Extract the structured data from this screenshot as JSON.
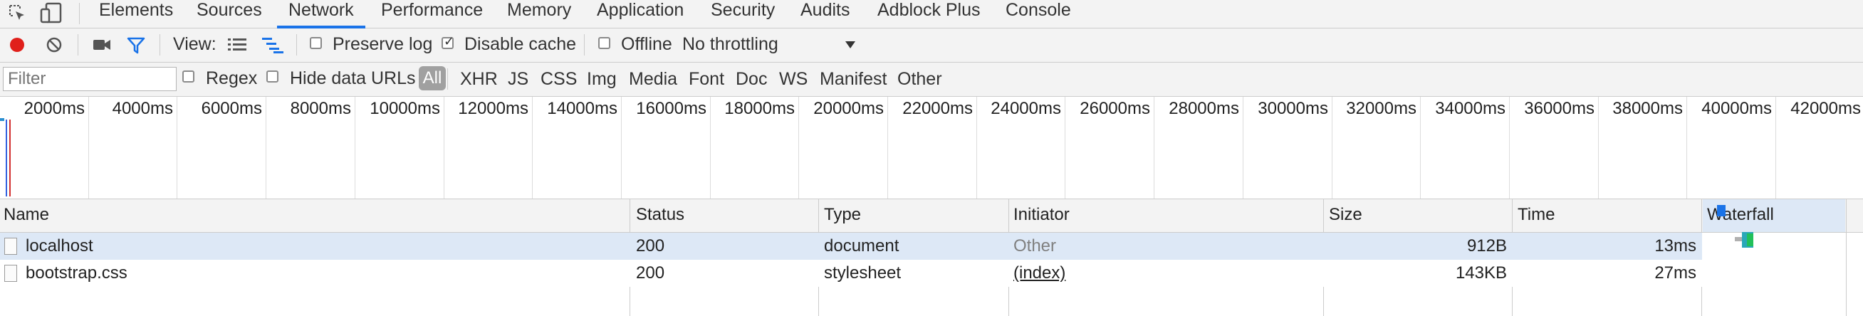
{
  "tabs": [
    "Elements",
    "Sources",
    "Network",
    "Performance",
    "Memory",
    "Application",
    "Security",
    "Audits",
    "Adblock Plus",
    "Console"
  ],
  "selected_tab": "Network",
  "toolbar": {
    "view_label": "View:",
    "preserve_log": {
      "label": "Preserve log",
      "checked": false
    },
    "disable_cache": {
      "label": "Disable cache",
      "checked": true
    },
    "offline": {
      "label": "Offline",
      "checked": false
    },
    "throttling": "No throttling",
    "record_color": "#e0201b",
    "accent_color": "#1a73e8",
    "icons": [
      "inspect-icon",
      "device-icon",
      "record-icon",
      "clear-icon",
      "camera-icon",
      "filter-icon",
      "large-rows-icon",
      "waterfall-overview-icon",
      "dropdown-icon"
    ]
  },
  "filterbar": {
    "filter_placeholder": "Filter",
    "regex": "Regex",
    "hide_data_urls": "Hide data URLs",
    "types": [
      "All",
      "XHR",
      "JS",
      "CSS",
      "Img",
      "Media",
      "Font",
      "Doc",
      "WS",
      "Manifest",
      "Other"
    ],
    "selected_type": "All"
  },
  "timeline_ticks": [
    "2000ms",
    "4000ms",
    "6000ms",
    "8000ms",
    "10000ms",
    "12000ms",
    "14000ms",
    "16000ms",
    "18000ms",
    "20000ms",
    "22000ms",
    "24000ms",
    "26000ms",
    "28000ms",
    "30000ms",
    "32000ms",
    "34000ms",
    "36000ms",
    "38000ms",
    "40000ms",
    "42000ms"
  ],
  "table": {
    "columns": [
      "Name",
      "Status",
      "Type",
      "Initiator",
      "Size",
      "Time",
      "Waterfall"
    ],
    "rows": [
      {
        "name": "localhost",
        "status": "200",
        "type": "document",
        "initiator": "Other",
        "size": "912B",
        "time": "13ms",
        "selected": true
      },
      {
        "name": "bootstrap.css",
        "status": "200",
        "type": "stylesheet",
        "initiator": "(index)",
        "size": "143KB",
        "time": "27ms",
        "selected": false
      }
    ]
  }
}
